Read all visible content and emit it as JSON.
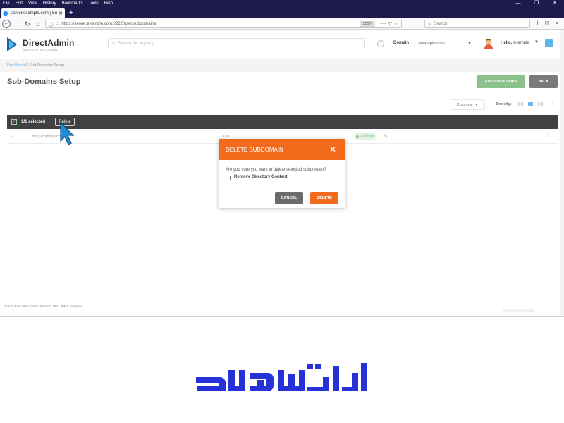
{
  "browser": {
    "menu": [
      "File",
      "Edit",
      "View",
      "History",
      "Bookmarks",
      "Tools",
      "Help"
    ],
    "tab_title": "server.example.com | Sub-Do",
    "url": "https://server.example.com:2222/user/subdomains",
    "zoom": "120%",
    "search_placeholder": "Search"
  },
  "header": {
    "logo_name": "DirectAdmin",
    "logo_tagline": "WEB CONTROL PANEL",
    "search_placeholder": "Search for anything...",
    "domain_label": "Domain",
    "domain_value": "example.com",
    "greeting_prefix": "Hello,",
    "username": "example"
  },
  "breadcrumb": {
    "home": "Dashboard",
    "current": "/ Sub-Domains Setup"
  },
  "page": {
    "title": "Sub-Domains Setup",
    "add_button": "ADD SUBDOMAIN",
    "back_button": "BACK",
    "columns_label": "Columns",
    "density_label": "Density:"
  },
  "selection": {
    "count_text": "1/1 selected",
    "delete_button": "Delete"
  },
  "table": {
    "rows": [
      {
        "name": "blog.example.com",
        "size": "0 B",
        "status": "Enabled"
      }
    ]
  },
  "modal": {
    "title": "DELETE SUBDOMAIN",
    "question": "Are you sure you want to delete selected subdomain?",
    "checkbox_label": "Remove Directory Content",
    "cancel_button": "CANCEL",
    "delete_button": "DELETE"
  },
  "footer": {
    "copyright": "DirectAdmin Web Control Panel © 2021 JBMC Software"
  },
  "colors": {
    "modal_accent": "#f26a1b",
    "selection_bar": "#404142",
    "brand_blue": "#2631d6"
  }
}
